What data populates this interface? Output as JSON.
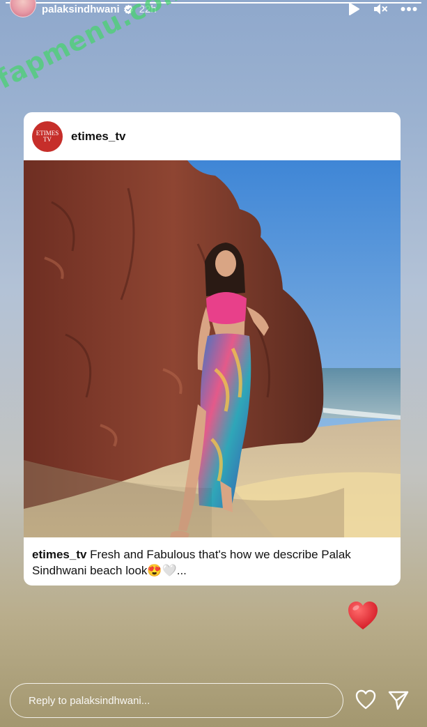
{
  "story": {
    "progress": 1.0,
    "username": "palaksindhwani",
    "verified": true,
    "time_ago": "22h",
    "controls": [
      "play-icon",
      "mute-icon",
      "more-icon"
    ]
  },
  "watermark": "fapmenu.com",
  "post": {
    "avatar_text": "ETIMES TV",
    "username": "etimes_tv",
    "caption_user": "etimes_tv",
    "caption_text": "Fresh and Fabulous that's how we describe Palak Sindhwani beach look😍🤍..."
  },
  "reaction": "heart-emoji-icon",
  "reply": {
    "placeholder": "Reply to palaksindhwani...",
    "like_icon": "heart-outline-icon",
    "send_icon": "paper-plane-icon"
  },
  "colors": {
    "background_top": "#8fa8cc",
    "background_bottom": "#a3976f",
    "watermark": "#46d26e",
    "etimes_red": "#c62e2a",
    "heart_red": "#e0242e"
  }
}
